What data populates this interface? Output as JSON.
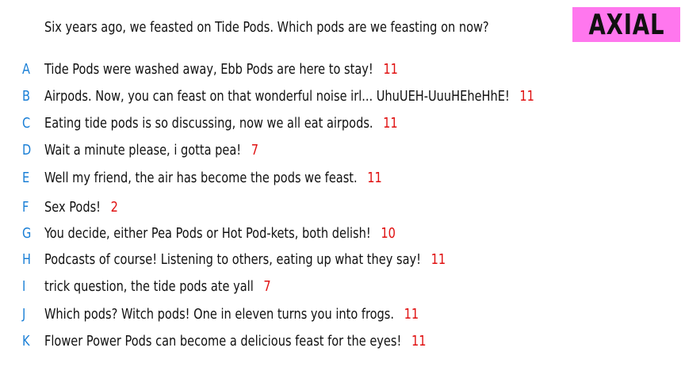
{
  "question": "Six years ago, we feasted on Tide Pods. Which pods are we feasting on now?",
  "logo": "AXIAL",
  "answers": [
    {
      "letter": "A",
      "text": "Tide Pods were washed away, Ebb Pods are here to stay!",
      "count": "11"
    },
    {
      "letter": "B",
      "text": "Airpods. Now, you can feast on that wonderful noise irl... UhuUEH-UuuHEheHhE!",
      "count": "11"
    },
    {
      "letter": "C",
      "text": "Eating tide pods is so discussing, now we all eat airpods.",
      "count": "11"
    },
    {
      "letter": "D",
      "text": "Wait a minute please, i gotta pea!",
      "count": "7"
    },
    {
      "letter": "E",
      "text": "Well my friend, the air has become the pods we feast.",
      "count": "11"
    },
    {
      "letter": "F",
      "text": "Sex Pods!",
      "count": "2"
    },
    {
      "letter": "G",
      "text": "You decide, either Pea Pods or Hot Pod-kets, both delish!",
      "count": "10"
    },
    {
      "letter": "H",
      "text": "Podcasts of course! Listening to others, eating up what they say!",
      "count": "11"
    },
    {
      "letter": "I",
      "text": "trick question, the tide pods ate yall",
      "count": "7"
    },
    {
      "letter": "J",
      "text": "Which pods? Witch pods! One in eleven turns you into frogs.",
      "count": "11"
    },
    {
      "letter": "K",
      "text": "Flower Power Pods can become a delicious feast for the eyes!",
      "count": "11"
    }
  ],
  "colors": {
    "letter": "#1a7fd6",
    "count": "#e01010",
    "logo_bg": "#ff77ee"
  }
}
